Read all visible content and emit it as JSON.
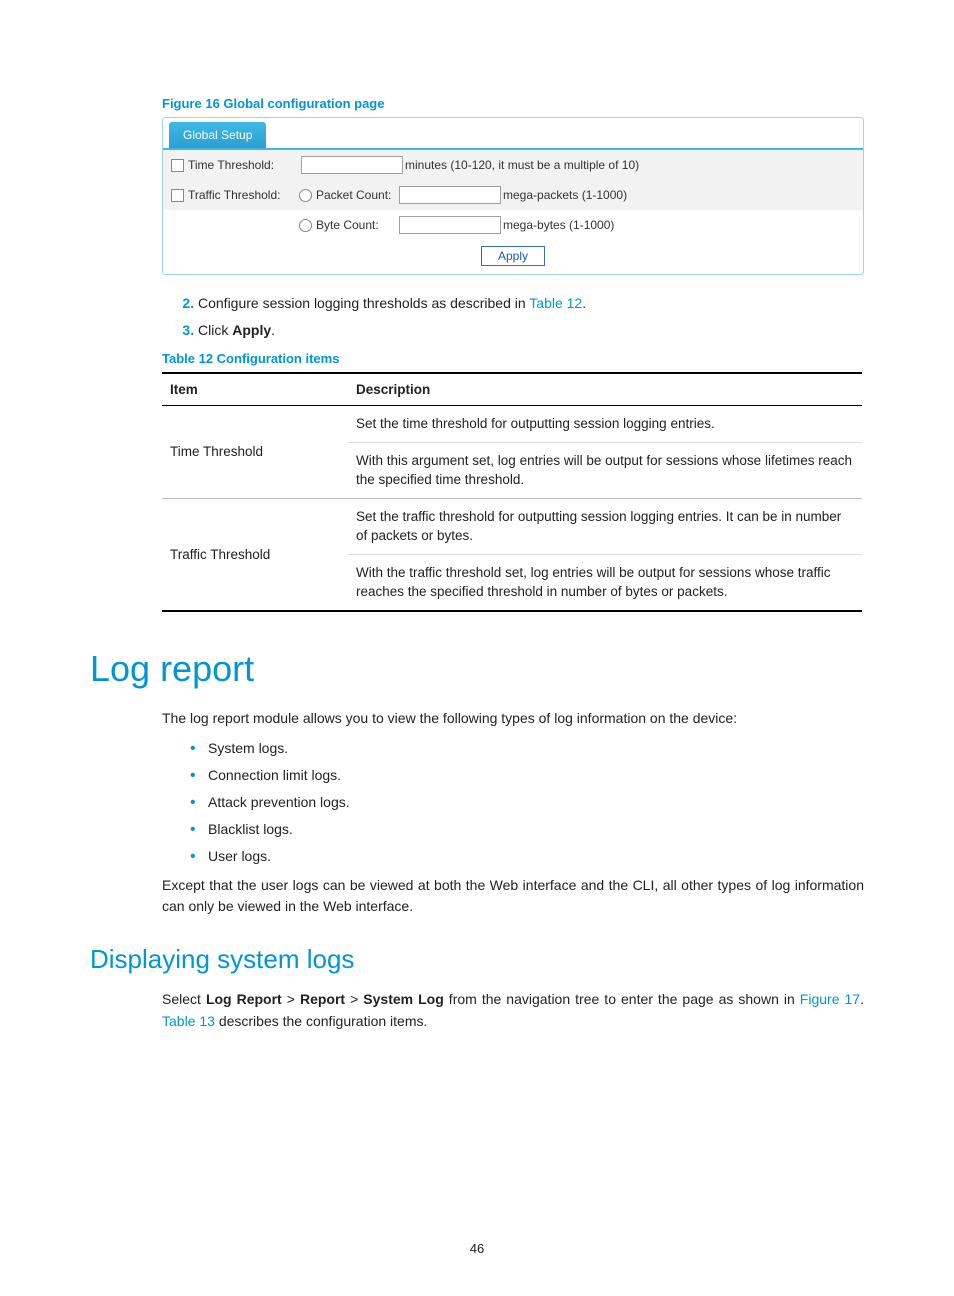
{
  "figure": {
    "caption": "Figure 16  Global configuration page",
    "tab": "Global Setup",
    "rows": {
      "time": {
        "label": "Time Threshold:",
        "hint": "minutes (10-120, it must be a multiple of 10)"
      },
      "traffic": {
        "label": "Traffic Threshold:",
        "packet_label": "Packet Count:",
        "packet_hint": "mega-packets (1-1000)",
        "byte_label": "Byte Count:",
        "byte_hint": "mega-bytes (1-1000)"
      }
    },
    "apply": "Apply"
  },
  "steps": {
    "s2a": "Configure session logging thresholds as described in ",
    "s2link": "Table 12",
    "s2b": ".",
    "s3a": "Click ",
    "s3b": "Apply",
    "s3c": "."
  },
  "tablecaption": "Table 12 Configuration items",
  "table": {
    "head_item": "Item",
    "head_desc": "Description",
    "r1_item": "Time Threshold",
    "r1_d1": "Set the time threshold for outputting session logging entries.",
    "r1_d2": "With this argument set, log entries will be output for sessions whose lifetimes reach the specified time threshold.",
    "r2_item": "Traffic Threshold",
    "r2_d1": "Set the traffic threshold for outputting session logging entries. It can be in number of packets or bytes.",
    "r2_d2": "With the traffic threshold set, log entries will be output for sessions whose traffic reaches the specified threshold in number of bytes or packets."
  },
  "logreport": {
    "h1": "Log report",
    "intro": "The log report module allows you to view the following types of log information on the device:",
    "bullets": [
      "System logs.",
      "Connection limit logs.",
      "Attack prevention logs.",
      "Blacklist logs.",
      "User logs."
    ],
    "note": "Except that the user logs can be viewed at both the Web interface and the CLI, all other types of log information can only be viewed in the Web interface."
  },
  "displaying": {
    "h2": "Displaying system logs",
    "p1a": "Select ",
    "p1b": "Log Report",
    "p1c": " > ",
    "p1d": "Report",
    "p1e": " > ",
    "p1f": "System Log",
    "p1g": " from the navigation tree to enter the page as shown in ",
    "link1": "Figure 17",
    "p1h": ". ",
    "link2": "Table 13",
    "p1i": " describes the configuration items."
  },
  "pagenum": "46"
}
